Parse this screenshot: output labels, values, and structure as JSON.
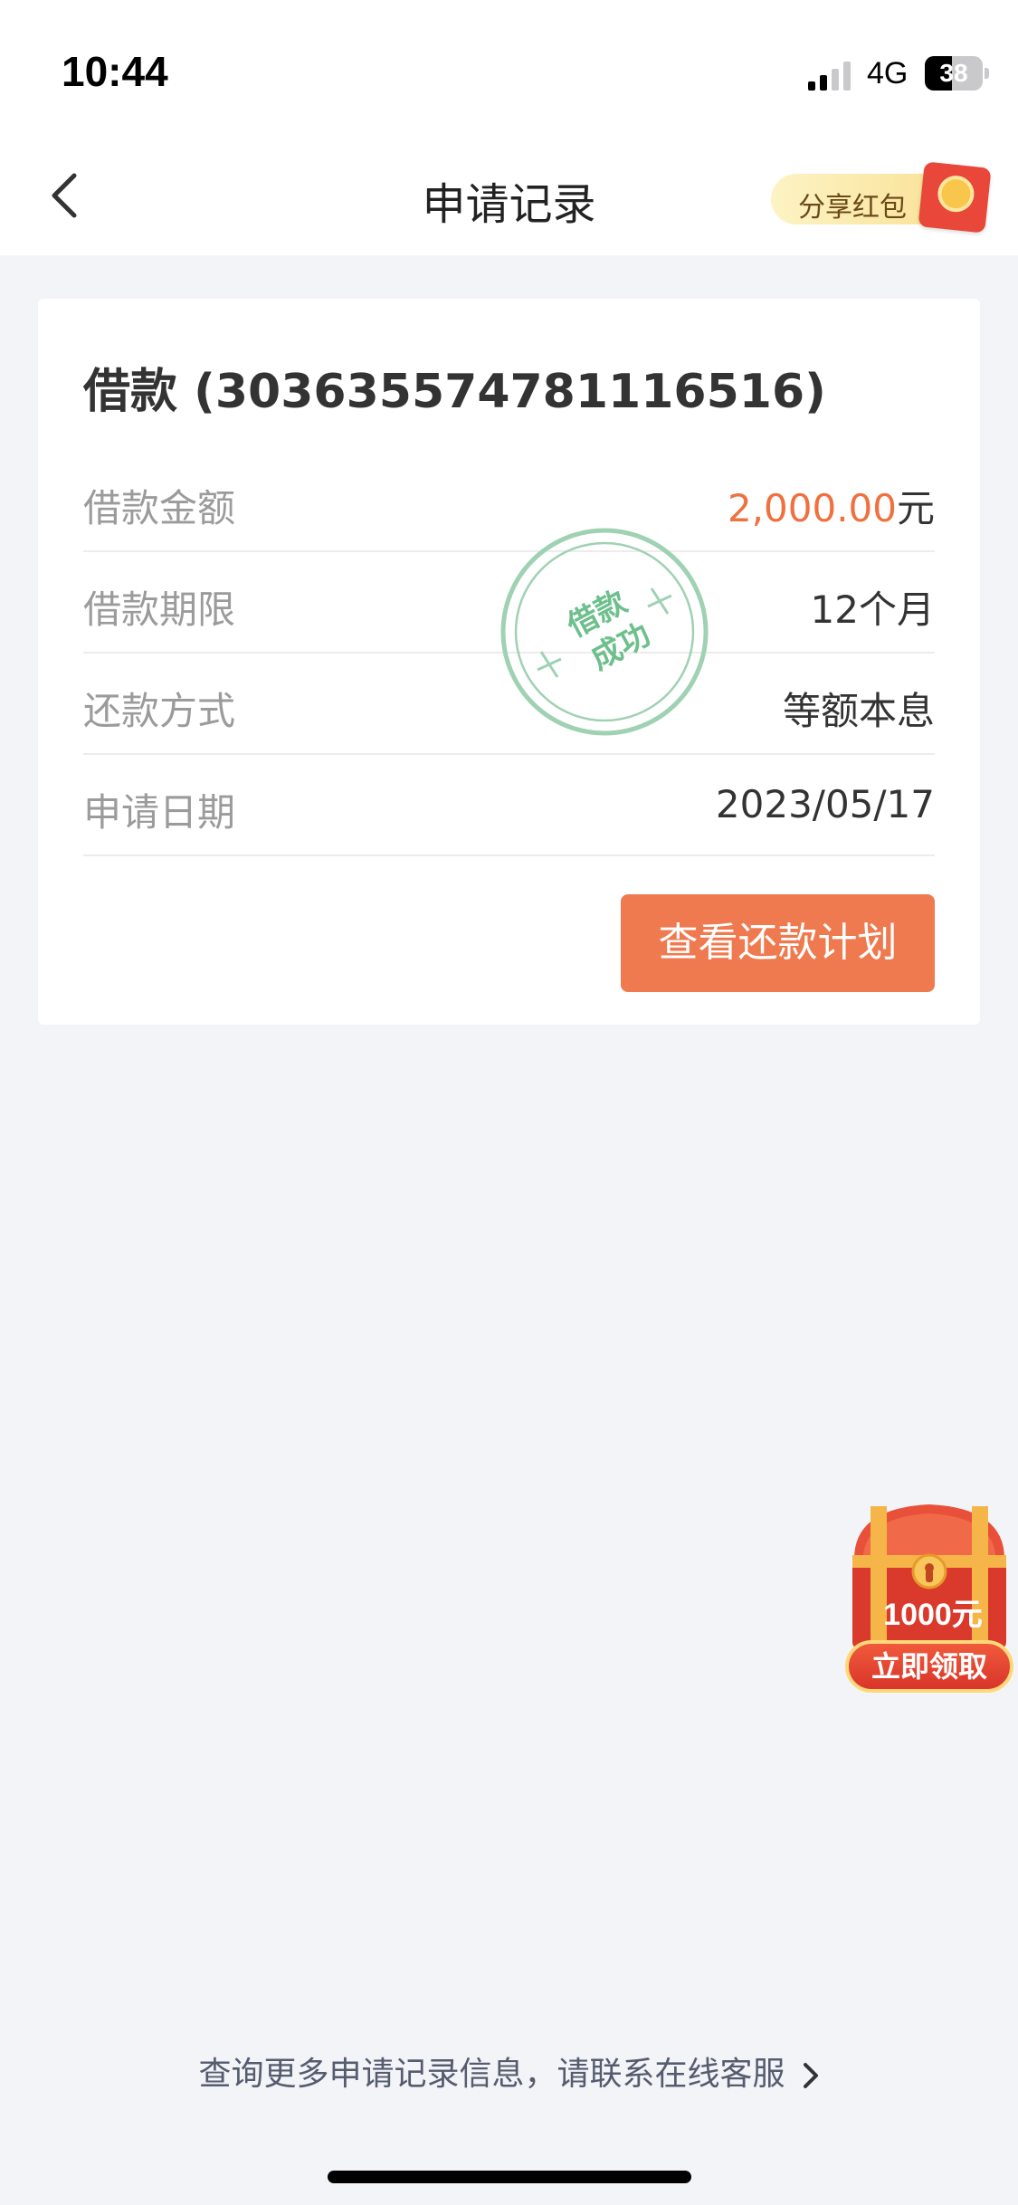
{
  "status_bar": {
    "time": "10:44",
    "network": "4G",
    "battery": "38"
  },
  "nav": {
    "title": "申请记录",
    "share_label": "分享红包"
  },
  "card": {
    "title": "借款 (303635574781116516)",
    "rows": [
      {
        "label": "借款金额",
        "value_number": "2,000.00",
        "value_unit": "元"
      },
      {
        "label": "借款期限",
        "value": "12个月"
      },
      {
        "label": "还款方式",
        "value": "等额本息"
      },
      {
        "label": "申请日期",
        "value": "2023/05/17"
      }
    ],
    "stamp": {
      "line1": "借款",
      "line2": "成功"
    },
    "button_label": "查看还款计划"
  },
  "promo": {
    "amount": "1000元",
    "button_label": "立即领取"
  },
  "footer": {
    "link_text": "查询更多申请记录信息，请联系在线客服"
  },
  "colors": {
    "accent": "#ef7a4f",
    "amount": "#f0703f",
    "stamp": "#8fcaa6",
    "background": "#f3f4f8"
  }
}
